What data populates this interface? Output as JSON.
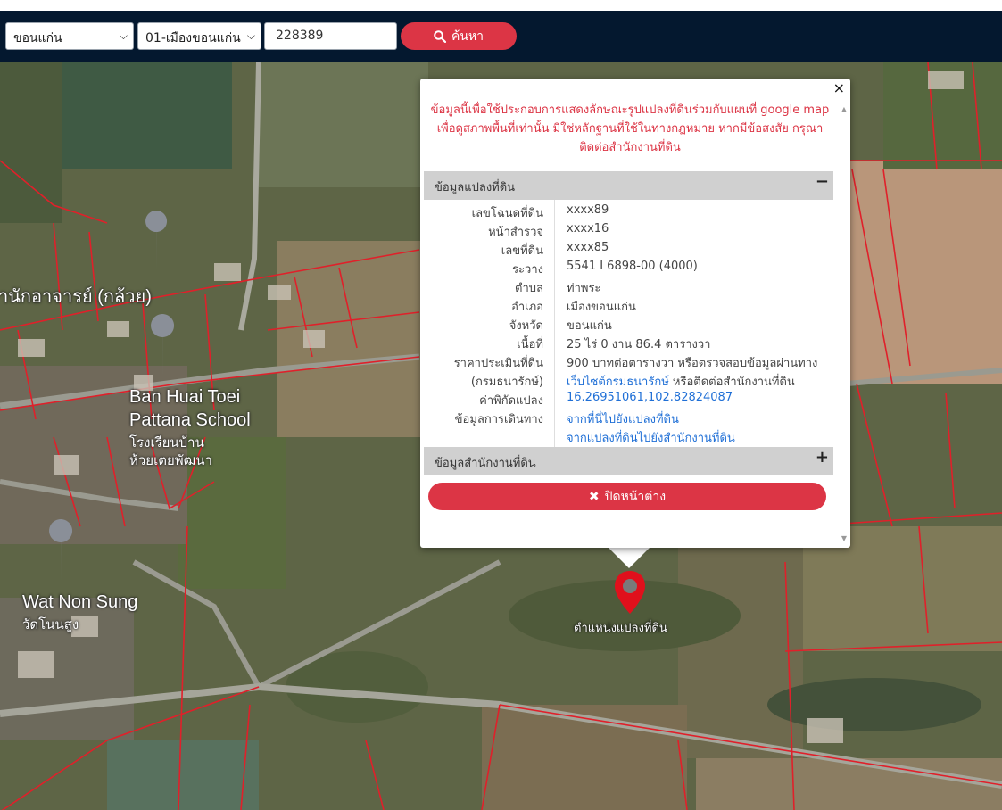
{
  "toolbar": {
    "province": "ขอนแก่น",
    "district": "01-เมืองขอนแก่น",
    "parcel_no": "228389",
    "search_label": "ค้นหา"
  },
  "map_labels": {
    "temple_fragment": "านักอาจารย์ (กล้วย)",
    "school_en_1": "Ban Huai Toei",
    "school_en_2": "Pattana School",
    "school_th_1": "โรงเรียนบ้าน",
    "school_th_2": "ห้วยเตยพัฒนา",
    "wat_en": "Wat Non Sung",
    "wat_th": "วัดโนนสูง",
    "pin_label": "ตำแหน่งแปลงที่ดิน"
  },
  "popup": {
    "disclaimer_1": "ข้อมูลนี้เพื่อใช้ประกอบการแสดงลักษณะรูปแปลงที่ดินร่วมกับแผนที่ google map",
    "disclaimer_2": "เพื่อดูสภาพพื้นที่เท่านั้น มิใช่หลักฐานที่ใช้ในทางกฎหมาย หากมีข้อสงสัย กรุณา",
    "disclaimer_3": "ติดต่อสำนักงานที่ดิน",
    "section_parcel": "ข้อมูลแปลงที่ดิน",
    "section_office": "ข้อมูลสำนักงานที่ดิน",
    "collapse_symbol": "−",
    "expand_symbol": "+",
    "close_symbol": "×",
    "close_button": "ปิดหน้าต่าง",
    "rows": [
      {
        "label": "เลขโฉนดที่ดิน",
        "value": "xxxx89"
      },
      {
        "label": "หน้าสำรวจ",
        "value": "xxxx16"
      },
      {
        "label": "เลขที่ดิน",
        "value": "xxxx85"
      },
      {
        "label": "ระวาง",
        "value": "5541 I 6898-00 (4000)"
      },
      {
        "label": "ตำบล",
        "value": "ท่าพระ"
      },
      {
        "label": "อำเภอ",
        "value": "เมืองขอนแก่น"
      },
      {
        "label": "จังหวัด",
        "value": "ขอนแก่น"
      },
      {
        "label": "เนื้อที่",
        "value": "25 ไร่ 0 งาน 86.4 ตารางวา"
      },
      {
        "label": "ราคาประเมินที่ดิน",
        "value": "900 บาทต่อตารางวา หรือตรวจสอบข้อมูลผ่านทาง"
      },
      {
        "label": "(กรมธนารักษ์)",
        "value_link": "เว็บไซต์กรมธนารักษ์",
        "value_suffix": " หรือติดต่อสำนักงานที่ดิน"
      },
      {
        "label": "ค่าพิกัดแปลง",
        "value_link": "16.26951061,102.82824087"
      },
      {
        "label": "ข้อมูลการเดินทาง",
        "value_link": "จากที่นี่ไปยังแปลงที่ดิน"
      },
      {
        "label": "",
        "value_link": "จากแปลงที่ดินไปยังสำนักงานที่ดิน"
      }
    ]
  },
  "colors": {
    "toolbar_bg": "#04182f",
    "accent_red": "#dc3545",
    "link_blue": "#1f6fd6",
    "parcel_line": "#e0202a"
  }
}
